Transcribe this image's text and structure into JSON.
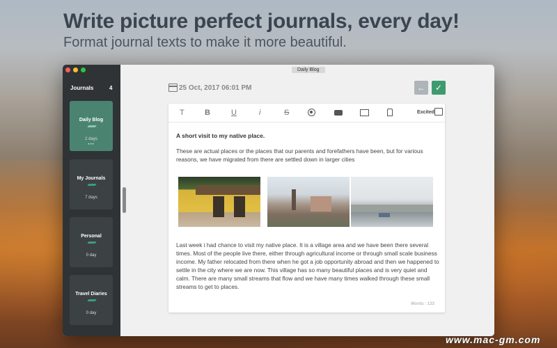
{
  "promo": {
    "headline": "Write picture perfect journals, every day!",
    "subline": "Format journal texts to make it more beautiful."
  },
  "window": {
    "tab_title": "Daily Blog"
  },
  "sidebar": {
    "title": "Journals",
    "count": "4",
    "journals": [
      {
        "name": "Daily Blog",
        "days": "2 days",
        "dots": "•••",
        "active": true
      },
      {
        "name": "My Journals",
        "days": "7 days"
      },
      {
        "name": "Personal",
        "days": "0 day"
      },
      {
        "name": "Travel Diaries",
        "days": "0 day"
      }
    ]
  },
  "header": {
    "date": "25 Oct, 2017 06:01 PM",
    "back_icon": "arrow-left-icon",
    "confirm_icon": "checkmark-icon",
    "back_glyph": "←",
    "confirm_glyph": "✓"
  },
  "toolbar": {
    "text_glyph": "T",
    "bold_glyph": "B",
    "underline_glyph": "U",
    "italic_glyph": "i",
    "strike_glyph": "S",
    "mood_label": "Excited"
  },
  "entry": {
    "title": "A short visit to my native place.",
    "para1": "These are actual places or the places that our parents and forefathers have been, but for various reasons, we have migrated from there are settled down in larger cities",
    "para2": "Last week i had chance to visit my native place. It is a village area and we have been there several times. Most of the people live there, either through agricultural income or through small scale business income. My father relocated from there when he got a job opportunity abroad and then we happened to settle in the city where we are now. This village has so many beautiful places and is very quiet and calm. There are many small streams that flow and we have many times walked through these small streams to get to places.",
    "words": "Words : 133"
  },
  "watermark": "www.mac-gm.com",
  "colors": {
    "accent": "#3f9b6f",
    "sidebar_bg": "#2f3336",
    "active_card": "#4a8470"
  }
}
